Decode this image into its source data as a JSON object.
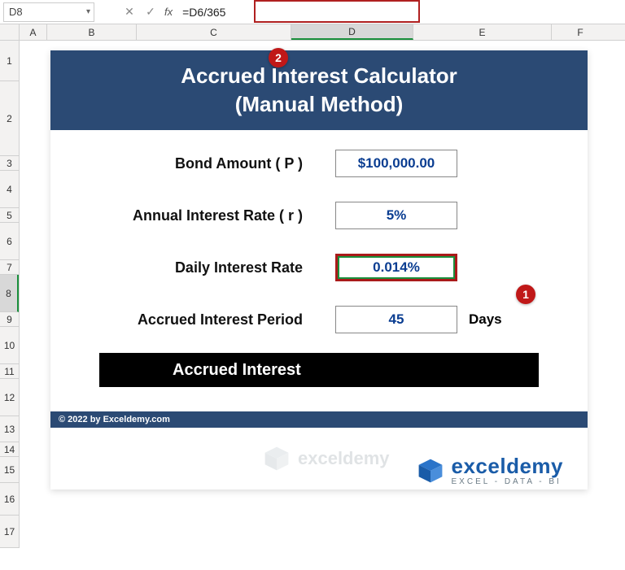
{
  "nameBox": "D8",
  "fxLabel": "fx",
  "formula": "=D6/365",
  "colHeaders": {
    "a": "A",
    "b": "B",
    "c": "C",
    "d": "D",
    "e": "E",
    "f": "F"
  },
  "rowHeaders": [
    "1",
    "2",
    "3",
    "4",
    "5",
    "6",
    "7",
    "8",
    "9",
    "10",
    "11",
    "12",
    "13",
    "14",
    "15",
    "16",
    "17"
  ],
  "title": {
    "line1": "Accrued Interest Calculator",
    "line2": "(Manual Method)"
  },
  "rows": {
    "bond": {
      "label": "Bond Amount ( P )",
      "value": "$100,000.00"
    },
    "annual": {
      "label": "Annual Interest Rate ( r )",
      "value": "5%"
    },
    "daily": {
      "label": "Daily Interest Rate",
      "value": "0.014%"
    },
    "period": {
      "label": "Accrued Interest Period",
      "value": "45",
      "unit": "Days"
    }
  },
  "accruedBar": "Accrued Interest",
  "copyright": "© 2022 by Exceldemy.com",
  "logo": {
    "name": "exceldemy",
    "tagline": "EXCEL - DATA - BI"
  },
  "callouts": {
    "c1": "1",
    "c2": "2"
  }
}
